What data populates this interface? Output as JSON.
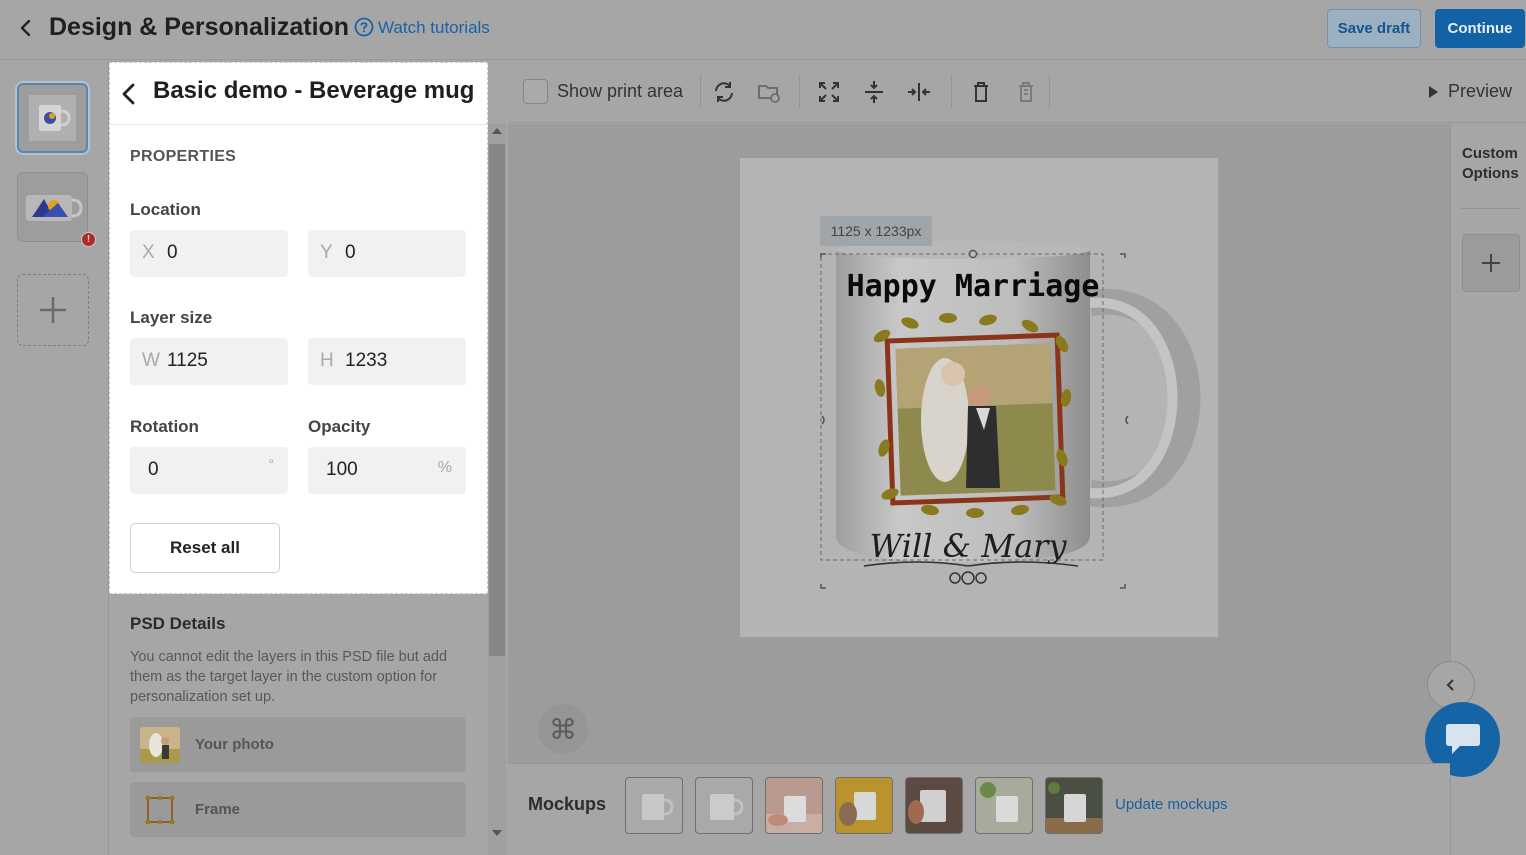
{
  "header": {
    "title": "Design & Personalization",
    "watch_tutorials": "Watch tutorials",
    "save_draft": "Save draft",
    "continue": "Continue"
  },
  "rail": {
    "error_badge": "!",
    "add_icon": "plus-icon"
  },
  "properties": {
    "layer_title": "Basic demo - Beverage mug",
    "section": "PROPERTIES",
    "location_label": "Location",
    "x_prefix": "X",
    "x_value": "0",
    "y_prefix": "Y",
    "y_value": "0",
    "layer_size_label": "Layer size",
    "w_prefix": "W",
    "w_value": "1125",
    "h_prefix": "H",
    "h_value": "1233",
    "rotation_label": "Rotation",
    "rotation_value": "0",
    "rotation_unit": "°",
    "opacity_label": "Opacity",
    "opacity_value": "100",
    "opacity_unit": "%",
    "reset_all": "Reset all"
  },
  "psd": {
    "title": "PSD Details",
    "description": "You cannot edit the layers in this PSD file but add them as the target layer in the custom option for personalization set up.",
    "items": [
      {
        "label": "Your photo"
      },
      {
        "label": "Frame"
      }
    ]
  },
  "toolbar": {
    "show_print_area": "Show print area",
    "preview": "Preview"
  },
  "canvas": {
    "dimension_badge": "1125 x 1233px",
    "mug_text_top": "Happy Marriage",
    "mug_text_bottom": "Will & Mary",
    "command_icon": "⌘"
  },
  "right_panel": {
    "title_line1": "Custom",
    "title_line2": "Options"
  },
  "mockups": {
    "label": "Mockups",
    "update_link": "Update mockups"
  },
  "colors": {
    "accent": "#1462a6",
    "link": "#1a62a8",
    "error": "#b12a2a"
  }
}
